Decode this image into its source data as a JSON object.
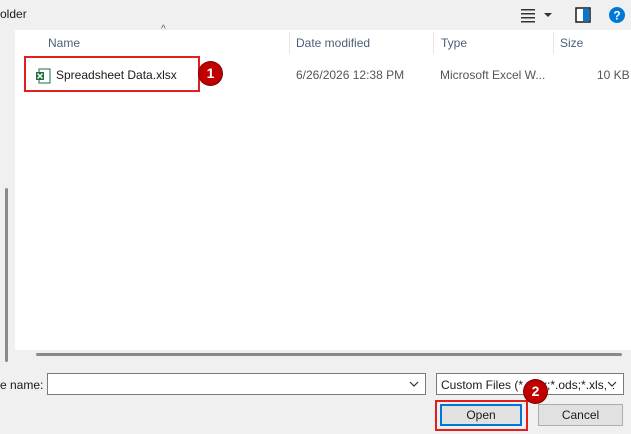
{
  "toolbar": {
    "title_fragment": "older",
    "view_icon": "list-view-icon",
    "pane_icon": "preview-pane-icon",
    "help_icon": "help-icon",
    "help_label": "?"
  },
  "columns": {
    "name": "Name",
    "date": "Date modified",
    "type": "Type",
    "size": "Size"
  },
  "files": [
    {
      "name": "Spreadsheet Data.xlsx",
      "date": "6/26/2026 12:38 PM",
      "type": "Microsoft Excel W...",
      "size": "10 KB",
      "icon": "excel-file-icon"
    }
  ],
  "footer": {
    "filename_label": "e name:",
    "filename_value": "",
    "filetype_value": "Custom Files (*.xlsx;*.ods;*.xls;*.",
    "open_label": "Open",
    "cancel_label": "Cancel"
  },
  "annotations": {
    "step1": "1",
    "step2": "2",
    "highlight_color": "#e02020",
    "badge_color": "#c00000"
  },
  "colors": {
    "accent": "#0078d7",
    "excel_green": "#1d6f42"
  }
}
